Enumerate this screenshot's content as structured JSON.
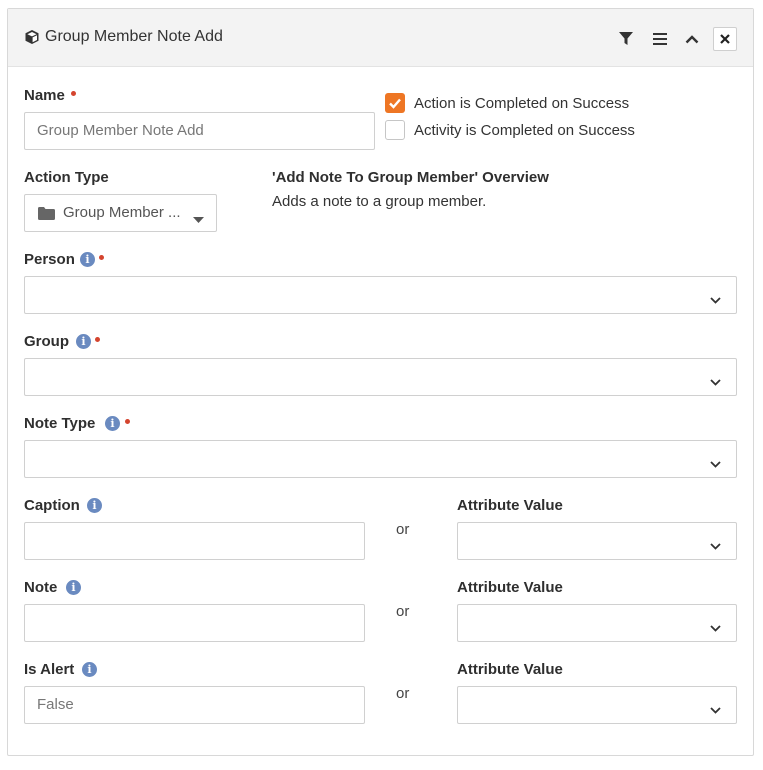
{
  "panel": {
    "title": "Group Member Note Add",
    "header_icons": [
      "cube-icon",
      "filter-icon",
      "menu-icon",
      "chevron-up-icon",
      "close-icon"
    ]
  },
  "name_field": {
    "label": "Name",
    "required": true,
    "value": "Group Member Note Add"
  },
  "checkboxes": [
    {
      "label": "Action is Completed on Success",
      "checked": true
    },
    {
      "label": "Activity is Completed on Success",
      "checked": false
    }
  ],
  "action_type": {
    "label": "Action Type",
    "value": "Group Member ..."
  },
  "overview": {
    "title": "'Add Note To Group Member' Overview",
    "description": "Adds a note to a group member."
  },
  "fields": {
    "person": {
      "label": "Person",
      "value": ""
    },
    "group": {
      "label": "Group",
      "value": ""
    },
    "note_type": {
      "label": "Note Type",
      "value": ""
    },
    "caption": {
      "label": "Caption",
      "value": ""
    },
    "note": {
      "label": "Note",
      "value": ""
    },
    "is_alert": {
      "label": "Is Alert",
      "value": "False"
    }
  },
  "or_text": "or",
  "attribute_value_label": "Attribute Value",
  "colors": {
    "accent": "#ee7624",
    "required": "#d4442e",
    "info": "#6a8ac0"
  }
}
